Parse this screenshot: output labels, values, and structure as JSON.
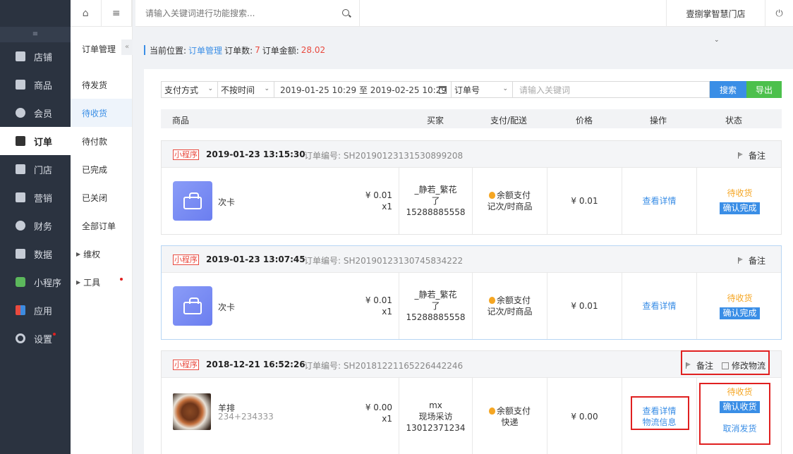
{
  "sidebar": {
    "collapse_icon": "menu-collapse-icon",
    "items": [
      {
        "label": "店铺",
        "icon": "store-icon"
      },
      {
        "label": "商品",
        "icon": "goods-icon"
      },
      {
        "label": "会员",
        "icon": "member-icon"
      },
      {
        "label": "订单",
        "icon": "order-icon",
        "active": true
      },
      {
        "label": "门店",
        "icon": "shop-icon"
      },
      {
        "label": "营销",
        "icon": "gift-icon"
      },
      {
        "label": "财务",
        "icon": "finance-icon"
      },
      {
        "label": "数据",
        "icon": "chart-icon"
      },
      {
        "label": "小程序",
        "icon": "miniprogram-icon"
      },
      {
        "label": "应用",
        "icon": "apps-icon"
      },
      {
        "label": "设置",
        "icon": "gear-icon",
        "dot": true
      }
    ]
  },
  "subnav": {
    "title": "订单管理",
    "collapse": "«",
    "items": [
      {
        "label": "待发货"
      },
      {
        "label": "待收货",
        "active": true
      },
      {
        "label": "待付款"
      },
      {
        "label": "已完成"
      },
      {
        "label": "已关闭"
      },
      {
        "label": "全部订单"
      },
      {
        "label": "维权",
        "expand": true
      },
      {
        "label": "工具",
        "expand": true,
        "dot": true
      }
    ]
  },
  "header": {
    "home_icon": "⌂",
    "menu_icon": "≡",
    "search_placeholder": "请输入关键词进行功能搜索...",
    "store_name": "壹捌掌智慧门店",
    "power_icon": "⏻"
  },
  "breadcrumb": {
    "prefix": "当前位置:",
    "current": "订单管理",
    "count_label": "订单数:",
    "count": "7",
    "amount_label": "订单金额:",
    "amount": "28.02"
  },
  "filters": {
    "pay_method": "支付方式",
    "time_type": "不按时间",
    "date_range": "2019-01-25 10:29 至 2019-02-25 10:29",
    "keyword_type": "订单号",
    "keyword_placeholder": "请输入关键词",
    "search_label": "搜索",
    "export_label": "导出"
  },
  "table_headers": {
    "goods": "商品",
    "buyer": "买家",
    "pay_ship": "支付/配送",
    "price": "价格",
    "action": "操作",
    "status": "状态"
  },
  "orders": [
    {
      "badge": "小程序",
      "datetime": "2019-01-23  13:15:30",
      "order_no": "订单编号: SH20190123131530899208",
      "remark": "备注",
      "goods_name": "次卡",
      "goods_price": "¥ 0.01",
      "goods_qty": "x1",
      "buyer_name_1": "_静若_繁花",
      "buyer_name_2": "了",
      "buyer_phone": "15288885558",
      "pay": "余额支付",
      "ship": "记次/时商品",
      "price": "¥ 0.01",
      "action": "查看详情",
      "status": "待收货",
      "status_btn": "确认完成"
    },
    {
      "badge": "小程序",
      "datetime": "2019-01-23  13:07:45",
      "order_no": "订单编号: SH20190123130745834222",
      "remark": "备注",
      "goods_name": "次卡",
      "goods_price": "¥ 0.01",
      "goods_qty": "x1",
      "buyer_name_1": "_静若_繁花",
      "buyer_name_2": "了",
      "buyer_phone": "15288885558",
      "pay": "余额支付",
      "ship": "记次/时商品",
      "price": "¥ 0.01",
      "action": "查看详情",
      "status": "待收货",
      "status_btn": "确认完成"
    },
    {
      "badge": "小程序",
      "datetime": "2018-12-21  16:52:26",
      "order_no": "订单编号: SH20181221165226442246",
      "remark": "备注",
      "logistics_edit": "修改物流",
      "goods_name": "羊排",
      "goods_spec": "234+234333",
      "goods_price": "¥ 0.00",
      "goods_qty": "x1",
      "buyer_name_1": "mx",
      "buyer_name_2": "现场采访",
      "buyer_phone": "13012371234",
      "pay": "余额支付",
      "ship": "快递",
      "price": "¥ 0.00",
      "action": "查看详情",
      "action_2": "物流信息",
      "status": "待收货",
      "status_btn": "确认收货",
      "cancel_ship": "取消发货"
    }
  ]
}
